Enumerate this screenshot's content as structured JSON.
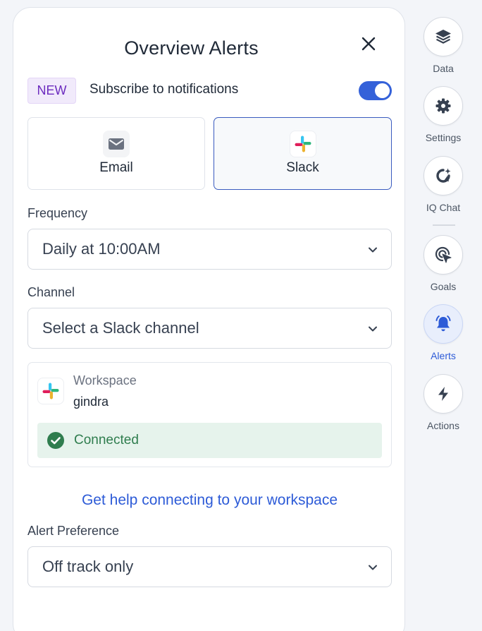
{
  "panel": {
    "title": "Overview Alerts",
    "new_badge": "NEW",
    "subscribe_label": "Subscribe to notifications",
    "subscribe_enabled": true
  },
  "methods": [
    {
      "label": "Email",
      "icon": "mail-icon",
      "selected": false
    },
    {
      "label": "Slack",
      "icon": "slack-icon",
      "selected": true
    }
  ],
  "frequency": {
    "label": "Frequency",
    "value": "Daily at 10:00AM"
  },
  "channel": {
    "label": "Channel",
    "placeholder": "Select a Slack channel"
  },
  "workspace": {
    "caption": "Workspace",
    "name": "gindra",
    "status": "Connected"
  },
  "help_link": "Get help connecting to your workspace",
  "alert_preference": {
    "label": "Alert Preference",
    "value": "Off track only"
  },
  "rail": [
    {
      "label": "Data",
      "icon": "layers-icon"
    },
    {
      "label": "Settings",
      "icon": "gear-icon"
    },
    {
      "label": "IQ Chat",
      "icon": "chat-icon"
    },
    {
      "label": "Goals",
      "icon": "target-cursor-icon"
    },
    {
      "label": "Alerts",
      "icon": "bell-icon",
      "active": true
    },
    {
      "label": "Actions",
      "icon": "lightning-icon"
    }
  ],
  "colors": {
    "accent": "#3461d9",
    "link": "#2d5bd7",
    "new_badge_bg": "#f1eafb",
    "new_badge_text": "#6c2bbf",
    "connected_bg": "#e6f3ec",
    "connected_text": "#2f7d4e"
  }
}
